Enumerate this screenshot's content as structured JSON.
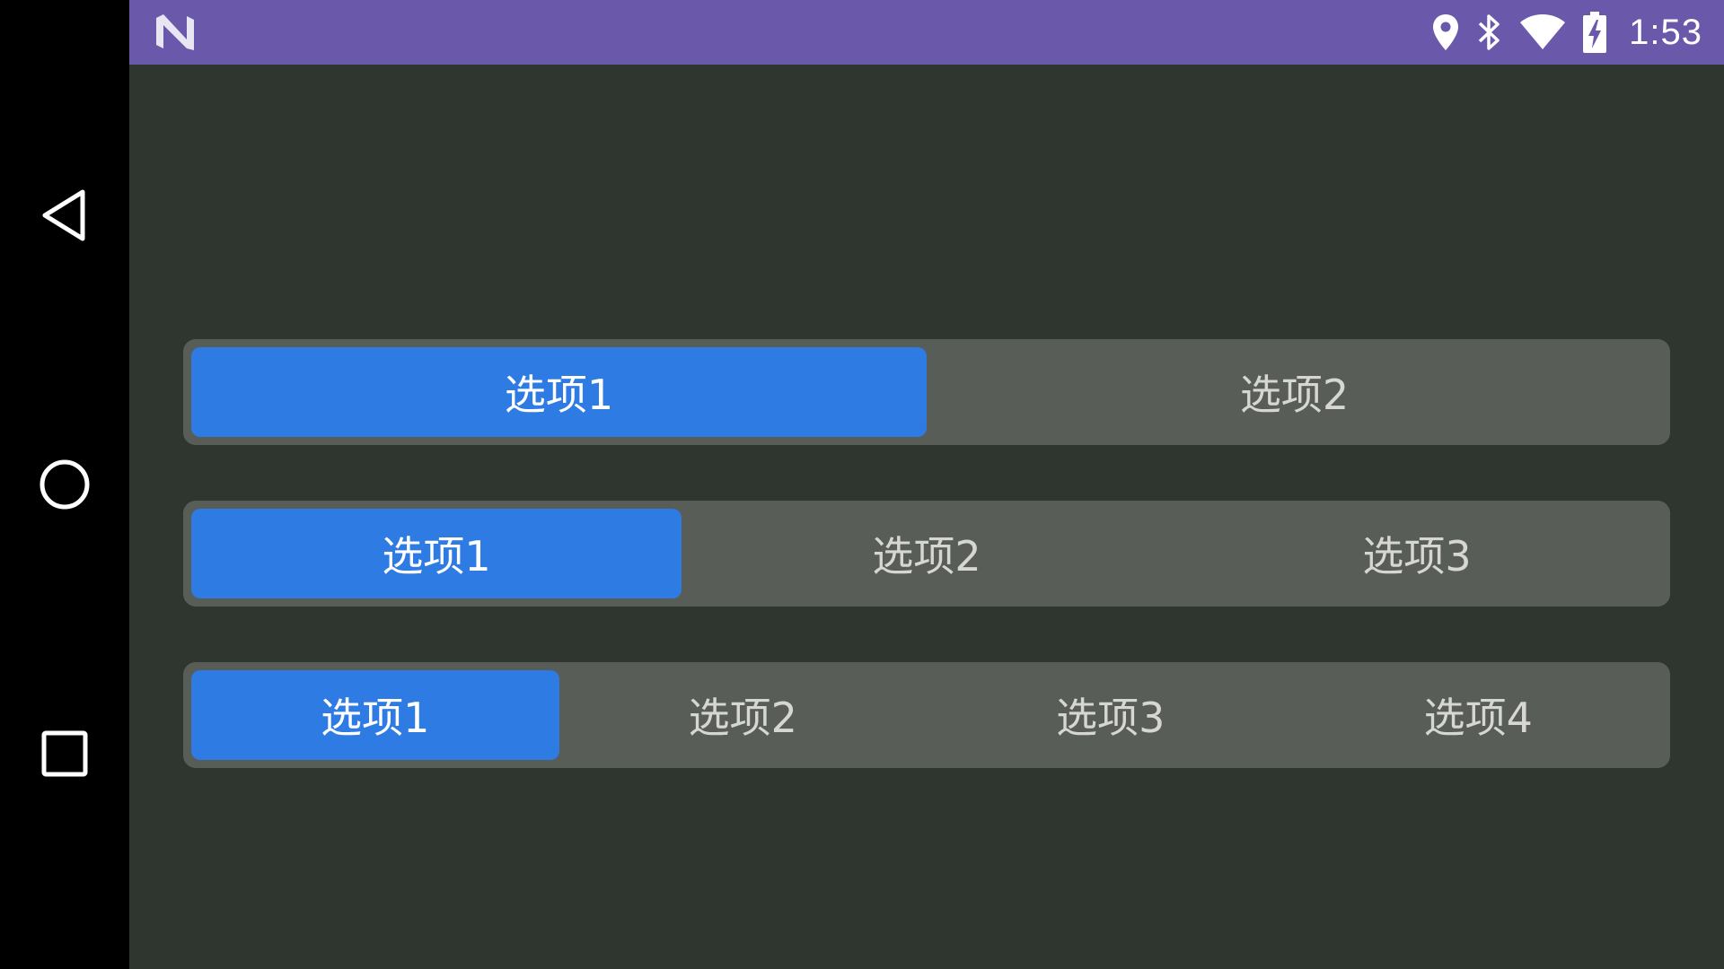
{
  "status_bar": {
    "time": "1:53",
    "icons": [
      "location-icon",
      "bluetooth-icon",
      "wifi-icon",
      "battery-charging-icon"
    ],
    "logo": "android-n-logo",
    "background": "#6a58ab"
  },
  "nav_bar": {
    "buttons": [
      "back-icon",
      "home-icon",
      "recents-icon"
    ]
  },
  "segmented_controls": [
    {
      "options": [
        "选项1",
        "选项2"
      ],
      "selected_index": 0
    },
    {
      "options": [
        "选项1",
        "选项2",
        "选项3"
      ],
      "selected_index": 0
    },
    {
      "options": [
        "选项1",
        "选项2",
        "选项3",
        "选项4"
      ],
      "selected_index": 0
    }
  ],
  "colors": {
    "accent": "#2e7be4",
    "control_background": "#585e57",
    "page_background": "#2f352f"
  }
}
